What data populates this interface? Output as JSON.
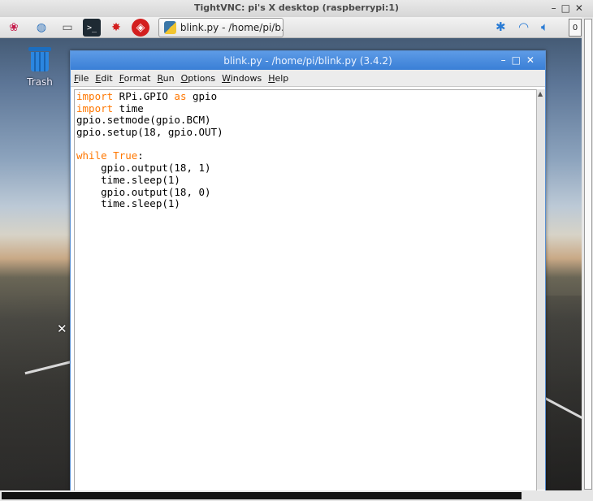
{
  "vnc": {
    "title": "TightVNC: pi's X desktop (raspberrypi:1)",
    "controls": "–□✕"
  },
  "panel": {
    "launchers": [
      {
        "name": "raspberry-menu-icon",
        "glyph": "❀"
      },
      {
        "name": "web-browser-icon",
        "glyph": "◍"
      },
      {
        "name": "file-manager-icon",
        "glyph": "▭"
      },
      {
        "name": "terminal-icon",
        "glyph": ">_"
      },
      {
        "name": "mathematica-icon",
        "glyph": "✸"
      },
      {
        "name": "wolfram-icon",
        "glyph": "◈"
      }
    ],
    "task_label": "blink.py - /home/pi/b...",
    "cpu_value": "0"
  },
  "desktop": {
    "trash_label": "Trash"
  },
  "editor": {
    "title": "blink.py - /home/pi/blink.py (3.4.2)",
    "controls": "–□✕",
    "menus": [
      {
        "key": "F",
        "rest": "ile"
      },
      {
        "key": "E",
        "rest": "dit"
      },
      {
        "key": "F",
        "rest": "ormat"
      },
      {
        "key": "R",
        "rest": "un"
      },
      {
        "key": "O",
        "rest": "ptions"
      },
      {
        "key": "W",
        "rest": "indows"
      },
      {
        "key": "H",
        "rest": "elp"
      }
    ],
    "code_lines": [
      [
        {
          "t": "import",
          "kw": true
        },
        {
          "t": " RPi.GPIO "
        },
        {
          "t": "as",
          "kw": true
        },
        {
          "t": " gpio"
        }
      ],
      [
        {
          "t": "import",
          "kw": true
        },
        {
          "t": " time"
        }
      ],
      [
        {
          "t": "gpio.setmode(gpio.BCM)"
        }
      ],
      [
        {
          "t": "gpio.setup(18, gpio.OUT)"
        }
      ],
      [
        {
          "t": ""
        }
      ],
      [
        {
          "t": "while",
          "kw": true
        },
        {
          "t": " "
        },
        {
          "t": "True",
          "kw": true
        },
        {
          "t": ":"
        }
      ],
      [
        {
          "t": "    gpio.output(18, 1)"
        }
      ],
      [
        {
          "t": "    time.sleep(1)"
        }
      ],
      [
        {
          "t": "    gpio.output(18, 0)"
        }
      ],
      [
        {
          "t": "    time.sleep(1)"
        }
      ]
    ]
  },
  "colors": {
    "keyword": "#ff7700",
    "title_bar": "#3a7fd6"
  }
}
